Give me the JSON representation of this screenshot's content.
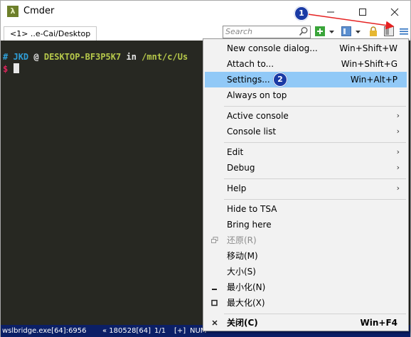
{
  "window": {
    "title": "Cmder",
    "app_icon": "λ"
  },
  "tab": {
    "label": "<1> ..e-Cai/Desktop"
  },
  "search": {
    "placeholder": "Search"
  },
  "console": {
    "hash": "#",
    "user": "JKD",
    "at": "@",
    "host": "DESKTOP-BF3P5K7",
    "in": "in",
    "path": "/mnt/c/Us",
    "prompt": "$"
  },
  "statusbar": {
    "process": "wslbridge.exe[64]:6956",
    "info": "« 180528[64]",
    "pages": "1/1",
    "plus": "[+]",
    "num": "NUM"
  },
  "menu": {
    "items": [
      {
        "label": "New console dialog...",
        "shortcut": "Win+Shift+W"
      },
      {
        "label": "Attach to...",
        "shortcut": "Win+Shift+G"
      },
      {
        "label": "Settings...",
        "shortcut": "Win+Alt+P"
      },
      {
        "label": "Always on top",
        "shortcut": ""
      },
      {
        "label": "Active console",
        "shortcut": "›"
      },
      {
        "label": "Console list",
        "shortcut": "›"
      },
      {
        "label": "Edit",
        "shortcut": "›"
      },
      {
        "label": "Debug",
        "shortcut": "›"
      },
      {
        "label": "Help",
        "shortcut": "›"
      },
      {
        "label": "Hide to TSA",
        "shortcut": ""
      },
      {
        "label": "Bring here",
        "shortcut": ""
      },
      {
        "label": "还原(R)",
        "shortcut": ""
      },
      {
        "label": "移动(M)",
        "shortcut": ""
      },
      {
        "label": "大小(S)",
        "shortcut": ""
      },
      {
        "label": "最小化(N)",
        "shortcut": ""
      },
      {
        "label": "最大化(X)",
        "shortcut": ""
      },
      {
        "label": "关闭(C)",
        "shortcut": "Win+F4"
      }
    ]
  },
  "annotations": {
    "badge1": "1",
    "badge2": "2"
  },
  "colors": {
    "console_bg": "#272822",
    "user": "#2f9fd8",
    "host": "#b6c84a",
    "path": "#b6c84a",
    "prompt": "#e0245c",
    "menu_selected": "#91c9f7",
    "statusbar": "#0b1f66",
    "badge": "#1a3aa5",
    "annotation_arrow": "#e52222"
  },
  "icons": [
    "lambda-icon",
    "minimize-icon",
    "maximize-icon",
    "close-icon",
    "search-icon",
    "new-console-icon",
    "dropdown-icon",
    "tile-icon",
    "lock-icon",
    "split-icon",
    "hamburger-menu-icon"
  ]
}
